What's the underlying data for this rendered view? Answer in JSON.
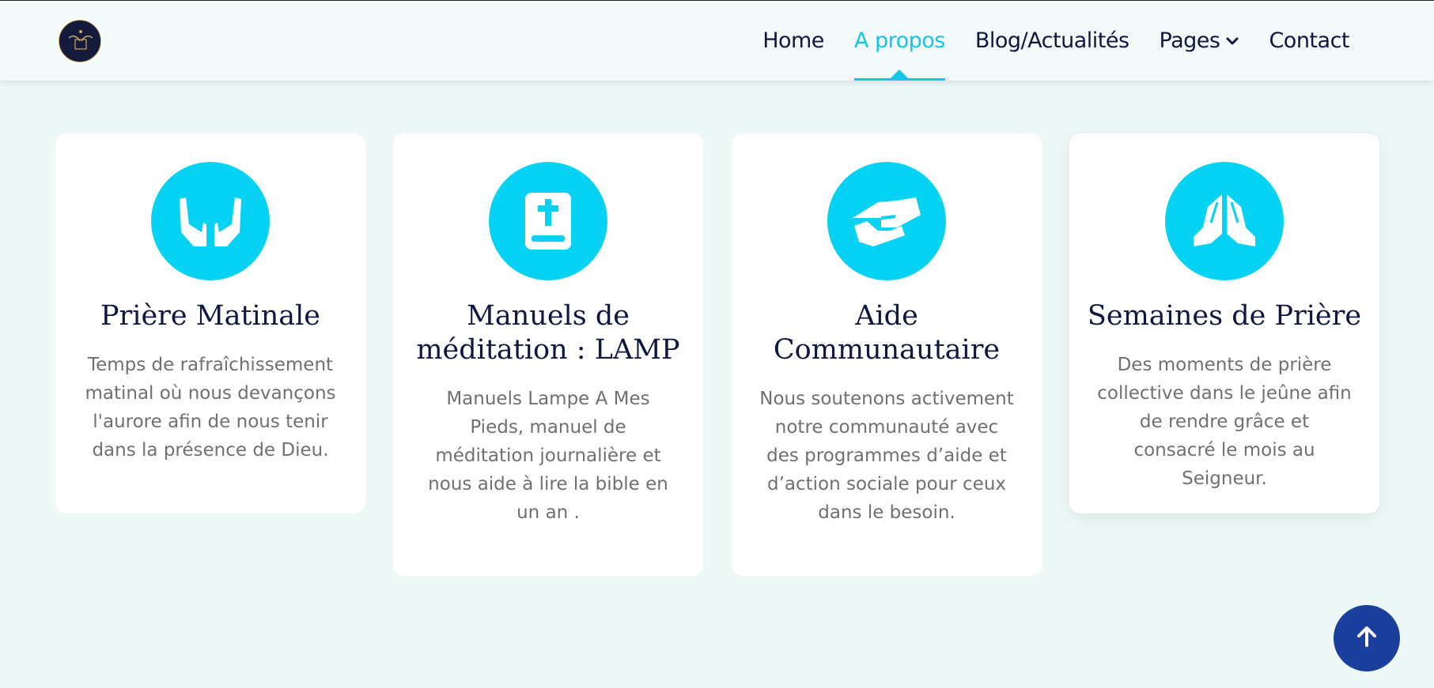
{
  "nav": {
    "items": [
      {
        "label": "Home",
        "active": false
      },
      {
        "label": "A propos",
        "active": true
      },
      {
        "label": "Blog/Actualités",
        "active": false
      },
      {
        "label": "Pages",
        "active": false
      },
      {
        "label": "Contact",
        "active": false
      }
    ]
  },
  "cards": [
    {
      "icon": "open-hands-icon",
      "title": "Prière Matinale",
      "text": "Temps de rafraîchissement matinal où nous devançons l'aurore afin de nous tenir dans la présence de Dieu."
    },
    {
      "icon": "bible-icon",
      "title": "Manuels de méditation : LAMP",
      "text": "Manuels Lampe A Mes Pieds, manuel de méditation journalière et nous aide à lire la bible en un an ."
    },
    {
      "icon": "handshake-icon",
      "title": "Aide Communautaire",
      "text": "Nous soutenons activement notre communauté avec des programmes d’aide et d’action sociale pour ceux dans le besoin."
    },
    {
      "icon": "praying-hands-icon",
      "title": "Semaines de Prière",
      "text": "Des moments de prière collective dans le jeûne afin de rendre grâce et consacré le mois au Seigneur."
    }
  ],
  "colors": {
    "accent": "#06d2f3",
    "nav_text": "#0f1640",
    "scroll_button": "#1a3f9c"
  }
}
